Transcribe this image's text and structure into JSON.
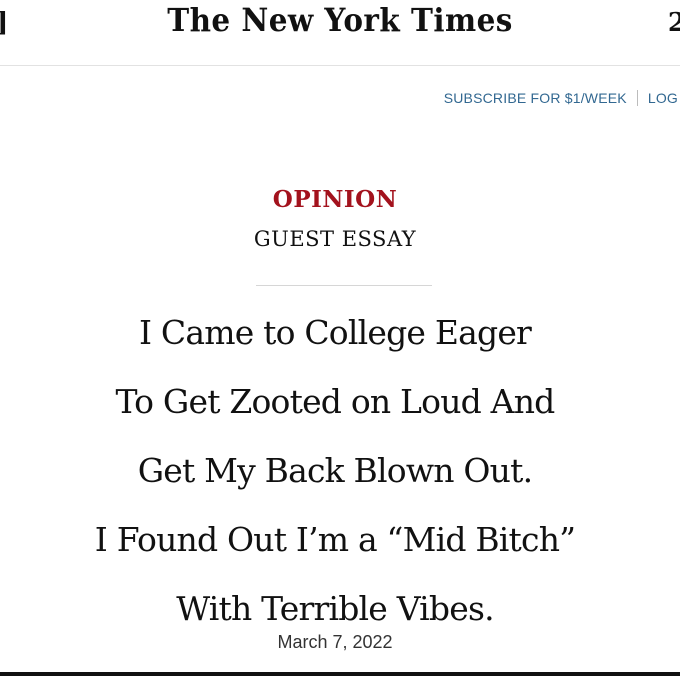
{
  "edges": {
    "left": "]",
    "right": "2"
  },
  "header": {
    "masthead": "The New York Times",
    "subscribe_label": "SUBSCRIBE FOR $1/WEEK",
    "login_label": "LOG"
  },
  "article": {
    "kicker": "OPINION",
    "section": "GUEST ESSAY",
    "headline_lines": [
      "I Came to College Eager",
      "To Get Zooted on Loud And",
      "Get My Back Blown Out.",
      "I Found Out I’m a “Mid Bitch”",
      "With Terrible Vibes."
    ],
    "date": "March 7, 2022"
  },
  "colors": {
    "kicker": "#a3121d",
    "link": "#326891",
    "text": "#111111"
  }
}
